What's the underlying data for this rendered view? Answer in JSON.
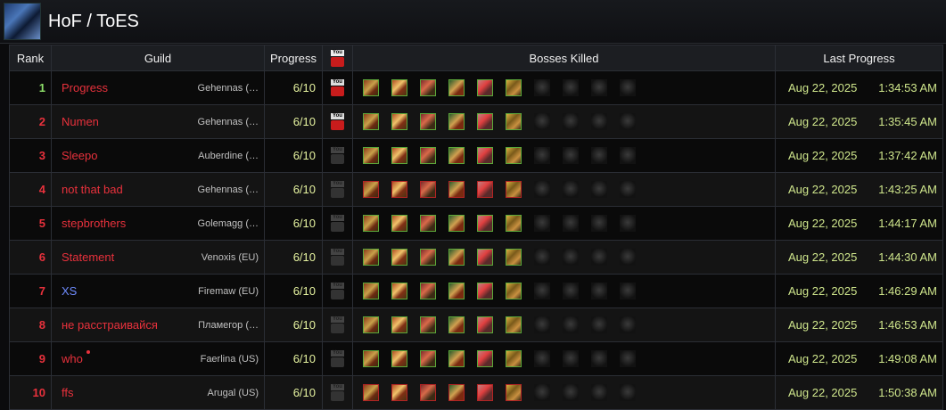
{
  "page": {
    "title": "HoF / ToES"
  },
  "table": {
    "headers": {
      "rank": "Rank",
      "guild": "Guild",
      "progress": "Progress",
      "video": "You Tube",
      "bosses": "Bosses Killed",
      "last": "Last Progress"
    },
    "rows": [
      {
        "rank": "1",
        "guild": "Progress",
        "realm": "Gehennas (…",
        "progress": "6/10",
        "video": true,
        "date": "Aug 22, 2025",
        "time": "1:34:53 AM",
        "rank_color": "#8ee06a",
        "kill_border": "green"
      },
      {
        "rank": "2",
        "guild": "Numen",
        "realm": "Gehennas (…",
        "progress": "6/10",
        "video": true,
        "date": "Aug 22, 2025",
        "time": "1:35:45 AM",
        "rank_color": "#e8313c",
        "kill_border": "green"
      },
      {
        "rank": "3",
        "guild": "Sleepo",
        "realm": "Auberdine (…",
        "progress": "6/10",
        "video": false,
        "date": "Aug 22, 2025",
        "time": "1:37:42 AM",
        "rank_color": "#e8313c",
        "kill_border": "green"
      },
      {
        "rank": "4",
        "guild": "not that bad",
        "realm": "Gehennas (…",
        "progress": "6/10",
        "video": false,
        "date": "Aug 22, 2025",
        "time": "1:43:25 AM",
        "rank_color": "#e8313c",
        "kill_border": "red"
      },
      {
        "rank": "5",
        "guild": "stepbrothers",
        "realm": "Golemagg (…",
        "progress": "6/10",
        "video": false,
        "date": "Aug 22, 2025",
        "time": "1:44:17 AM",
        "rank_color": "#e8313c",
        "kill_border": "green"
      },
      {
        "rank": "6",
        "guild": "Statement",
        "realm": "Venoxis (EU)",
        "progress": "6/10",
        "video": false,
        "date": "Aug 22, 2025",
        "time": "1:44:30 AM",
        "rank_color": "#e8313c",
        "kill_border": "green"
      },
      {
        "rank": "7",
        "guild": "XS",
        "realm": "Firemaw (EU)",
        "progress": "6/10",
        "video": false,
        "date": "Aug 22, 2025",
        "time": "1:46:29 AM",
        "rank_color": "#e8313c",
        "guild_color": "#6f8cff",
        "kill_border": "green"
      },
      {
        "rank": "8",
        "guild": "не расстраивайся",
        "realm": "Пламегор (…",
        "progress": "6/10",
        "video": false,
        "date": "Aug 22, 2025",
        "time": "1:46:53 AM",
        "rank_color": "#e8313c",
        "kill_border": "green"
      },
      {
        "rank": "9",
        "guild": "who",
        "realm": "Faerlina (US)",
        "progress": "6/10",
        "video": false,
        "date": "Aug 22, 2025",
        "time": "1:49:08 AM",
        "rank_color": "#e8313c",
        "kill_border": "green",
        "guild_marker": true
      },
      {
        "rank": "10",
        "guild": "ffs",
        "realm": "Arugal (US)",
        "progress": "6/10",
        "video": false,
        "date": "Aug 22, 2025",
        "time": "1:50:38 AM",
        "rank_color": "#e8313c",
        "kill_border": "red"
      }
    ],
    "bosses_total": 10,
    "bosses_killed": 6
  }
}
